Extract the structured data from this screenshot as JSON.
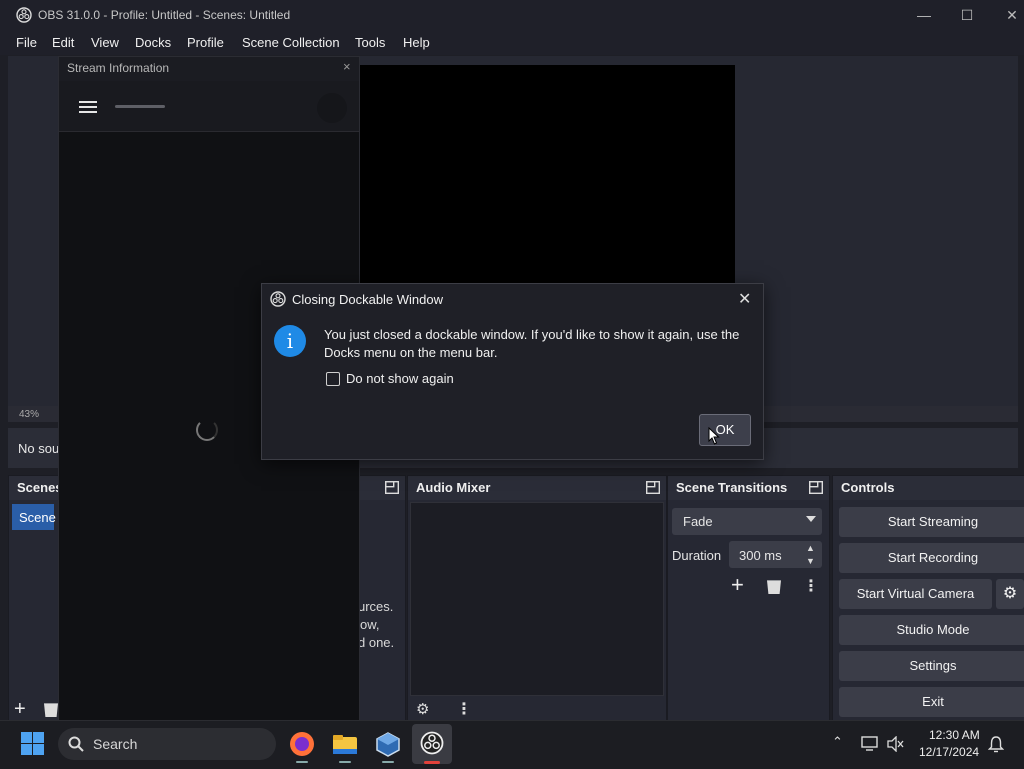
{
  "window": {
    "title": "OBS 31.0.0 - Profile: Untitled - Scenes: Untitled"
  },
  "menu": [
    "File",
    "Edit",
    "View",
    "Docks",
    "Profile",
    "Scene Collection",
    "Tools",
    "Help"
  ],
  "stream_dock": {
    "title": "Stream Information",
    "close": "×"
  },
  "preview": {
    "zoom": "43%",
    "no_source": "No sou"
  },
  "docks": {
    "scenes": {
      "title": "Scenes",
      "item": "Scene"
    },
    "sources": {
      "text_lines": [
        "urces.",
        "ow,",
        "d one."
      ]
    },
    "audio_mixer": {
      "title": "Audio Mixer"
    },
    "transitions": {
      "title": "Scene Transitions",
      "selected": "Fade",
      "duration_label": "Duration",
      "duration_value": "300 ms"
    },
    "controls": {
      "title": "Controls",
      "buttons": [
        "Start Streaming",
        "Start Recording",
        "Start Virtual Camera",
        "Studio Mode",
        "Settings",
        "Exit"
      ]
    }
  },
  "dialog": {
    "title": "Closing Dockable Window",
    "message": "You just closed a dockable window. If you'd like to show it again, use the Docks menu on the menu bar.",
    "checkbox": "Do not show again",
    "ok": "OK",
    "info_glyph": "i"
  },
  "taskbar": {
    "search": "Search",
    "time": "12:30 AM",
    "date": "12/17/2024"
  },
  "colors": {
    "accent": "#2a5ea8",
    "info": "#1f8ae6"
  }
}
